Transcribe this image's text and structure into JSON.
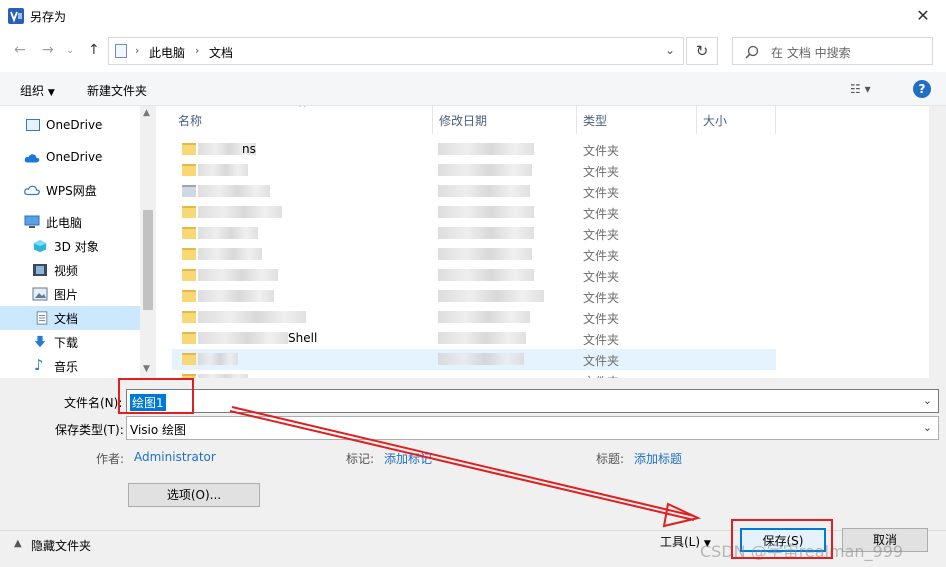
{
  "window": {
    "title": "另存为"
  },
  "address": {
    "segments": [
      "此电脑",
      "文档"
    ]
  },
  "search": {
    "placeholder": "在 文档 中搜索"
  },
  "toolbar": {
    "organize": "组织",
    "new_folder": "新建文件夹"
  },
  "sidebar": {
    "items": [
      {
        "label": "OneDrive"
      },
      {
        "label": "OneDrive"
      },
      {
        "label": "WPS网盘"
      },
      {
        "label": "此电脑"
      },
      {
        "label": "3D 对象"
      },
      {
        "label": "视频"
      },
      {
        "label": "图片"
      },
      {
        "label": "文档"
      },
      {
        "label": "下载"
      },
      {
        "label": "音乐"
      }
    ]
  },
  "columns": {
    "name": "名称",
    "modified": "修改日期",
    "type": "类型",
    "size": "大小"
  },
  "rows": [
    {
      "name": "ns",
      "type": "文件夹"
    },
    {
      "name": "",
      "type": "文件夹"
    },
    {
      "name": "",
      "type": "文件夹"
    },
    {
      "name": "",
      "type": "文件夹"
    },
    {
      "name": "",
      "type": "文件夹"
    },
    {
      "name": "",
      "type": "文件夹"
    },
    {
      "name": "",
      "type": "文件夹"
    },
    {
      "name": "",
      "type": "文件夹"
    },
    {
      "name": "",
      "type": "文件夹"
    },
    {
      "name": "Shell",
      "type": "文件夹"
    },
    {
      "name": "",
      "type": "文件夹"
    },
    {
      "name": "",
      "type": "文件夹"
    }
  ],
  "form": {
    "filename_label": "文件名(N):",
    "filename_value": "绘图1",
    "filetype_label": "保存类型(T):",
    "filetype_value": "Visio 绘图",
    "author_label": "作者:",
    "author_value": "Administrator",
    "tags_label": "标记:",
    "tags_value": "添加标记",
    "title_label": "标题:",
    "title_value": "添加标题",
    "options_button": "选项(O)..."
  },
  "footer": {
    "hide_folders": "隐藏文件夹",
    "tools": "工具(L)",
    "save": "保存(S)",
    "cancel": "取消"
  },
  "watermark": "CSDN @宇宙realman_999",
  "colors": {
    "accent": "#0078d7",
    "annotation": "#e02020"
  }
}
